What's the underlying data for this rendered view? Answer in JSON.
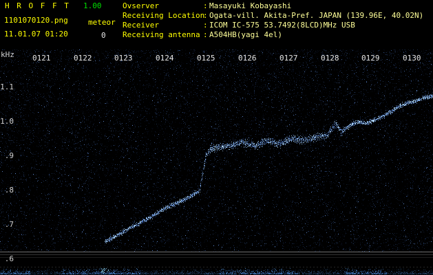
{
  "header": {
    "app_title": "H R O F F T",
    "version": "1.00",
    "filename": "1101070120.png",
    "meteor_label": "meteor",
    "meteor_count": "0",
    "timestamp": "11.01.07 01:20",
    "separator": ":",
    "info": [
      {
        "label": "Ovserver",
        "value": "Masayuki Kobayashi"
      },
      {
        "label": "Receiving Location",
        "value": "Ogata-vill. Akita-Pref. JAPAN (139.96E, 40.02N)"
      },
      {
        "label": "Receiver",
        "value": "ICOM IC-575 53.7492(8LCD)MHz USB"
      },
      {
        "label": "Receiving antenna",
        "value": "A504HB(yagi 4el)"
      }
    ]
  },
  "colors": {
    "background": "#000000",
    "label_yellow": "#ffff00",
    "value_yellow": "#ffff99",
    "version_green": "#00dd00",
    "tick_white": "#e6e6e6",
    "noise_blue": "#2255cc",
    "trace_blue": "#66aaff"
  },
  "chart_data": {
    "type": "heatmap",
    "subtype": "radio-meteor-spectrogram",
    "x_ticks": [
      "0121",
      "0122",
      "0123",
      "0124",
      "0125",
      "0126",
      "0127",
      "0128",
      "0129",
      "0130"
    ],
    "x_range": [
      "0120",
      "0130"
    ],
    "ylabel": "kHz",
    "y_ticks": [
      "1.1",
      "1.0",
      ".9",
      ".8",
      ".7",
      ".6"
    ],
    "y_tick_freqs_khz": [
      1.1,
      1.0,
      0.9,
      0.8,
      0.7,
      0.6
    ],
    "y_range_khz": [
      0.62,
      1.21
    ],
    "carrier_trace_points_t_min_f_khz": [
      [
        2.55,
        0.65
      ],
      [
        2.85,
        0.67
      ],
      [
        3.2,
        0.694
      ],
      [
        3.6,
        0.718
      ],
      [
        4.0,
        0.748
      ],
      [
        4.3,
        0.764
      ],
      [
        4.6,
        0.78
      ],
      [
        4.85,
        0.8
      ],
      [
        5.0,
        0.9
      ],
      [
        5.1,
        0.92
      ],
      [
        5.3,
        0.925
      ],
      [
        5.6,
        0.93
      ],
      [
        5.9,
        0.94
      ],
      [
        6.2,
        0.93
      ],
      [
        6.5,
        0.945
      ],
      [
        6.8,
        0.935
      ],
      [
        7.1,
        0.95
      ],
      [
        7.4,
        0.945
      ],
      [
        7.7,
        0.955
      ],
      [
        7.95,
        0.96
      ],
      [
        8.15,
        0.995
      ],
      [
        8.3,
        0.97
      ],
      [
        8.5,
        0.99
      ],
      [
        8.7,
        1.0
      ],
      [
        8.9,
        0.995
      ],
      [
        9.1,
        1.005
      ],
      [
        9.3,
        1.015
      ],
      [
        9.5,
        1.03
      ],
      [
        9.7,
        1.045
      ],
      [
        9.9,
        1.055
      ],
      [
        10.1,
        1.06
      ],
      [
        10.3,
        1.07
      ],
      [
        10.55,
        1.075
      ]
    ],
    "noise_seed": 20110107
  }
}
